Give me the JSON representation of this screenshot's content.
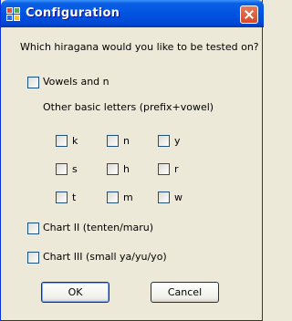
{
  "window": {
    "title": "Configuration",
    "close_icon": "close-icon",
    "app_icon": "windows-app-icon"
  },
  "prompt": "Which hiragana would you like to be tested on?",
  "options": {
    "vowels_and_n": "Vowels and n",
    "other_basic_heading": "Other basic letters (prefix+vowel)",
    "chart2": "Chart II (tenten/maru)",
    "chart3": "Chart III (small ya/yu/yo)"
  },
  "grid": [
    [
      "k",
      "n",
      "y"
    ],
    [
      "s",
      "h",
      "r"
    ],
    [
      "t",
      "m",
      "w"
    ]
  ],
  "buttons": {
    "ok": "OK",
    "cancel": "Cancel"
  }
}
